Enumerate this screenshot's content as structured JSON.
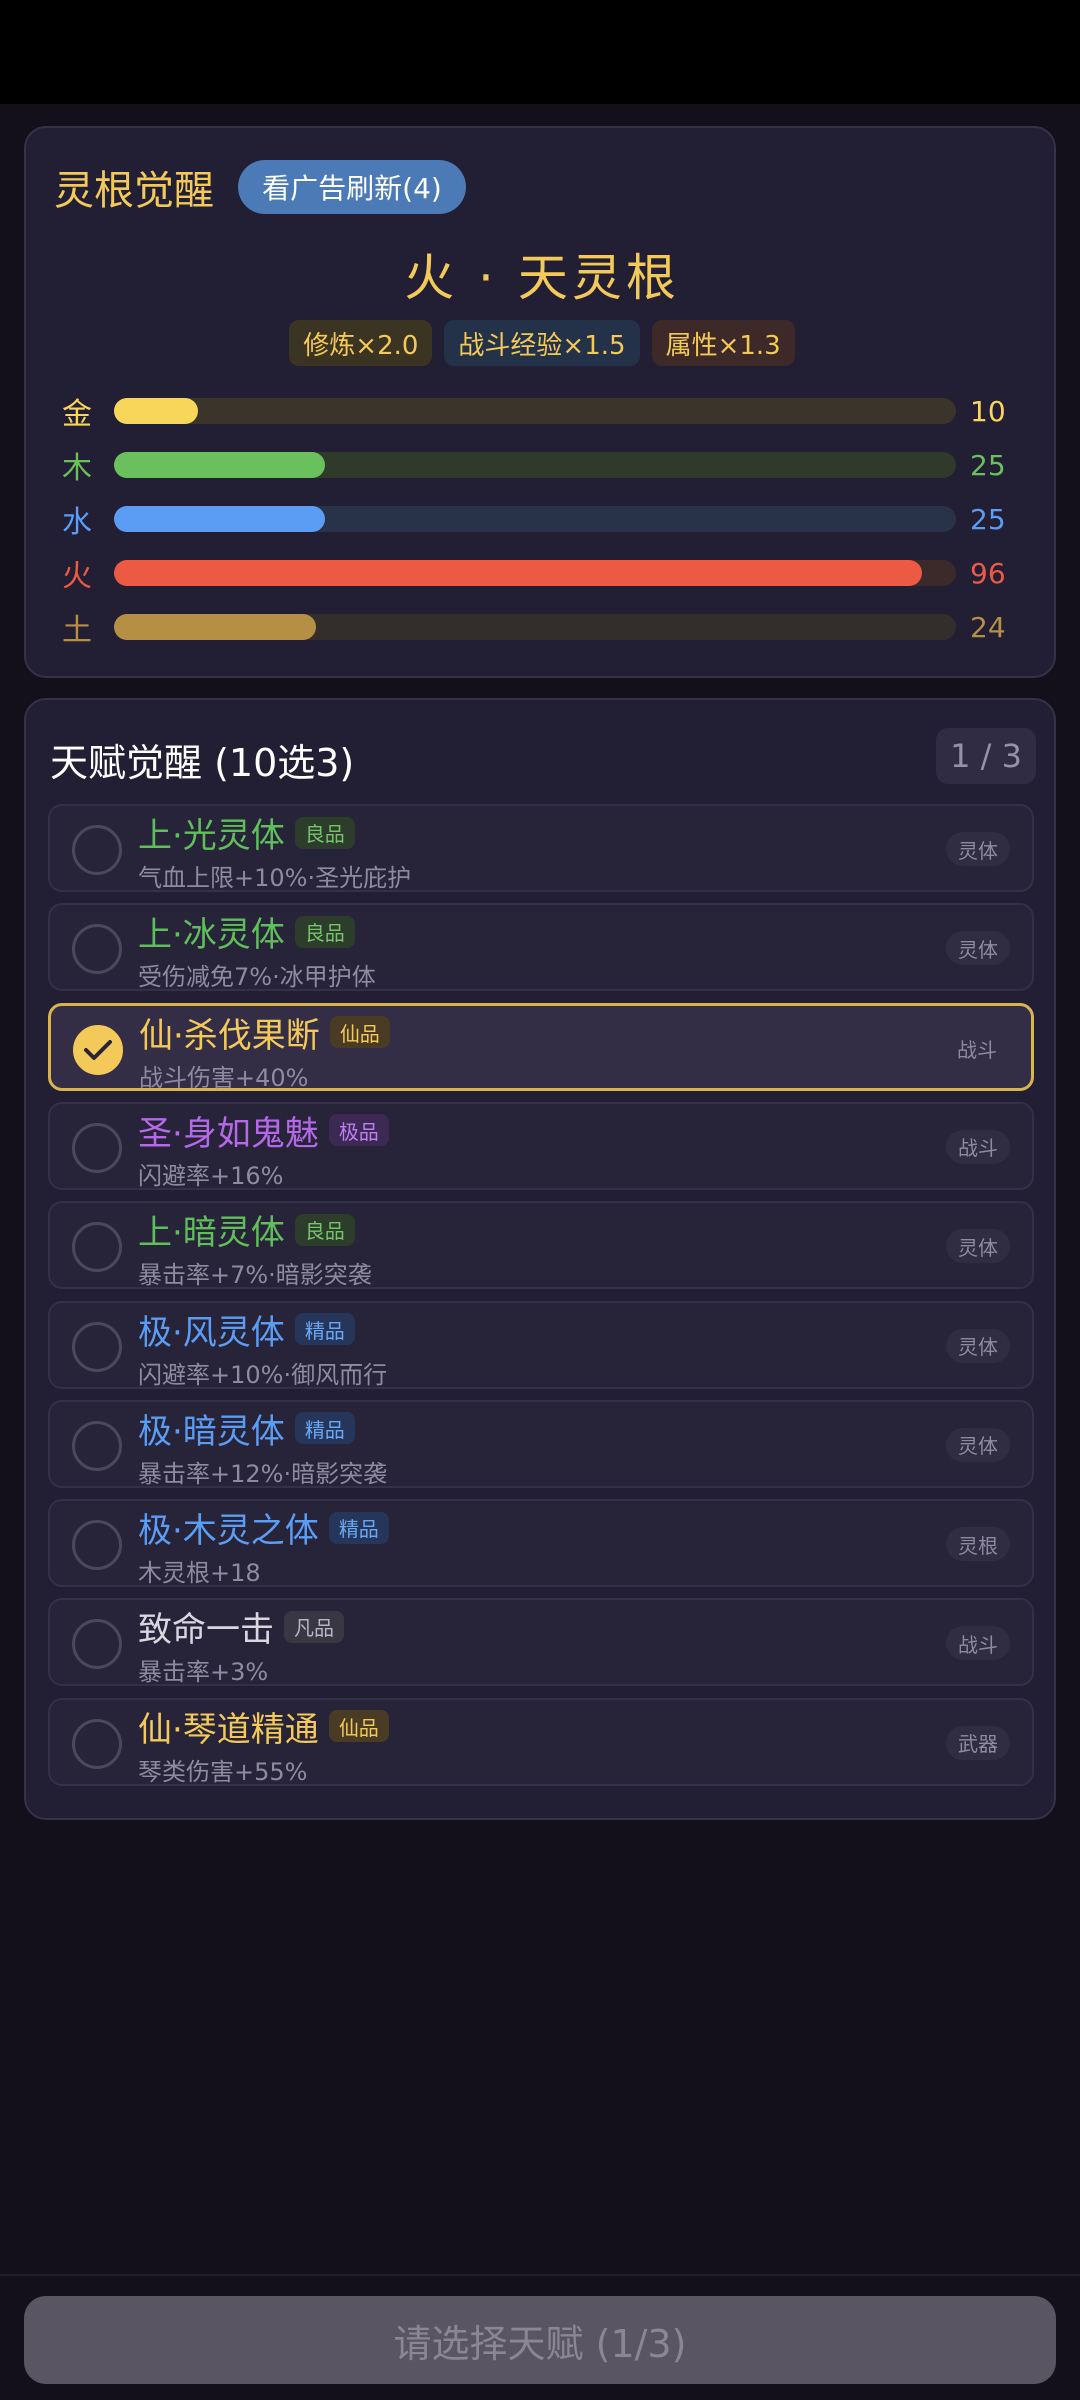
{
  "header": {
    "title": "灵根觉醒",
    "ad_refresh_label": "看广告刷新(4)"
  },
  "root": {
    "name": "火 · 天灵根",
    "bonuses": [
      "修炼×2.0",
      "战斗经验×1.5",
      "属性×1.3"
    ]
  },
  "elements": [
    {
      "label": "金",
      "value": 10,
      "level": 0.1,
      "color": "#f8d65a",
      "track": "#3b342a"
    },
    {
      "label": "木",
      "value": 25,
      "level": 0.25,
      "color": "#6ac05c",
      "track": "#2f3a2a"
    },
    {
      "label": "水",
      "value": 25,
      "level": 0.25,
      "color": "#5b9cf5",
      "track": "#283249"
    },
    {
      "label": "火",
      "value": 96,
      "level": 0.96,
      "color": "#ec5a44",
      "track": "#3c2a2b"
    },
    {
      "label": "土",
      "value": 24,
      "level": 0.24,
      "color": "#b58f44",
      "track": "#332e2b"
    }
  ],
  "talents_section": {
    "title": "天赋觉醒 (10选3)",
    "page": "1 / 3"
  },
  "talents": [
    {
      "name": "上·光灵体",
      "grade": "良品",
      "desc": "气血上限+10%·圣光庇护",
      "tag": "灵体",
      "selected": false,
      "color": "#5fbf5a"
    },
    {
      "name": "上·冰灵体",
      "grade": "良品",
      "desc": "受伤减免7%·冰甲护体",
      "tag": "灵体",
      "selected": false,
      "color": "#5fbf5a"
    },
    {
      "name": "仙·杀伐果断",
      "grade": "仙品",
      "desc": "战斗伤害+40%",
      "tag": "战斗",
      "selected": true,
      "color": "#f3c95a"
    },
    {
      "name": "圣·身如鬼魅",
      "grade": "极品",
      "desc": "闪避率+16%",
      "tag": "战斗",
      "selected": false,
      "color": "#b569e8"
    },
    {
      "name": "上·暗灵体",
      "grade": "良品",
      "desc": "暴击率+7%·暗影突袭",
      "tag": "灵体",
      "selected": false,
      "color": "#5fbf5a"
    },
    {
      "name": "极·风灵体",
      "grade": "精品",
      "desc": "闪避率+10%·御风而行",
      "tag": "灵体",
      "selected": false,
      "color": "#5b9cf5"
    },
    {
      "name": "极·暗灵体",
      "grade": "精品",
      "desc": "暴击率+12%·暗影突袭",
      "tag": "灵体",
      "selected": false,
      "color": "#5b9cf5"
    },
    {
      "name": "极·木灵之体",
      "grade": "精品",
      "desc": "木灵根+18",
      "tag": "灵根",
      "selected": false,
      "color": "#5b9cf5"
    },
    {
      "name": "致命一击",
      "grade": "凡品",
      "desc": "暴击率+3%",
      "tag": "战斗",
      "selected": false,
      "color": "#d9d6e2"
    },
    {
      "name": "仙·琴道精通",
      "grade": "仙品",
      "desc": "琴类伤害+55%",
      "tag": "武器",
      "selected": false,
      "color": "#f3c95a"
    }
  ],
  "footer": {
    "submit_label": "请选择天赋 (1/3)"
  }
}
